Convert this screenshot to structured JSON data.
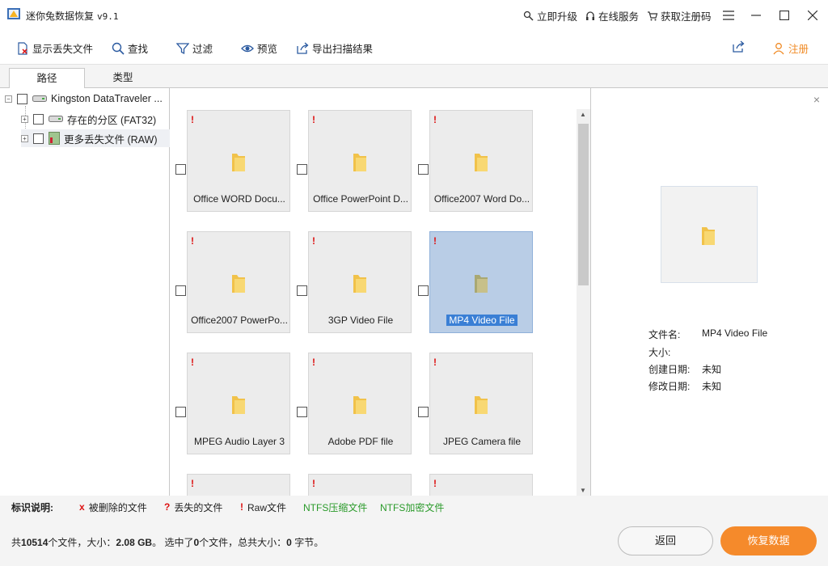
{
  "app": {
    "title": "迷你兔数据恢复",
    "version": "v9.1"
  },
  "topbar": {
    "upgrade": "立即升级",
    "online_service": "在线服务",
    "get_code": "获取注册码"
  },
  "toolbar": {
    "show_lost": "显示丢失文件",
    "find": "查找",
    "filter": "过滤",
    "preview": "预览",
    "export": "导出扫描结果",
    "register": "注册",
    "register_color": "#f08a24"
  },
  "tabs": [
    "路径",
    "类型"
  ],
  "tree": {
    "root": "Kingston DataTraveler ...",
    "children": [
      {
        "label": "存在的分区 (FAT32)"
      },
      {
        "label": "更多丢失文件 (RAW)"
      }
    ]
  },
  "grid": {
    "items": [
      {
        "caption": "Office WORD Docu...",
        "lost_mark": "!"
      },
      {
        "caption": "Office PowerPoint D...",
        "lost_mark": "!"
      },
      {
        "caption": "Office2007 Word Do...",
        "lost_mark": "!"
      },
      {
        "caption": "Office2007 PowerPo...",
        "lost_mark": "!"
      },
      {
        "caption": "3GP Video File",
        "lost_mark": "!"
      },
      {
        "caption": "MP4 Video File",
        "lost_mark": "!",
        "selected": true
      },
      {
        "caption": "MPEG Audio Layer 3",
        "lost_mark": "!"
      },
      {
        "caption": "Adobe PDF file",
        "lost_mark": "!"
      },
      {
        "caption": "JPEG Camera file",
        "lost_mark": "!"
      },
      {
        "caption": "",
        "lost_mark": "!"
      },
      {
        "caption": "",
        "lost_mark": "!"
      },
      {
        "caption": "",
        "lost_mark": "!"
      }
    ]
  },
  "preview": {
    "close": "×",
    "file_name_label": "文件名:",
    "file_name": "MP4 Video File",
    "size_label": "大小:",
    "size": "",
    "created_label": "创建日期:",
    "created": "未知",
    "modified_label": "修改日期:",
    "modified": "未知"
  },
  "legend": {
    "title": "标识说明:",
    "deleted_mark": "x",
    "deleted": "被删除的文件",
    "lost_mark": "?",
    "lost": "丢失的文件",
    "raw_mark": "!",
    "raw": "Raw文件",
    "ntfs_compressed": "NTFS压缩文件",
    "ntfs_encrypted": "NTFS加密文件",
    "mark_color": "#d11111",
    "ntfs_color": "#2a9a2a"
  },
  "status": {
    "p1": "共",
    "file_count": "10514",
    "p2": "个文件，大小：",
    "size": "2.08 GB",
    "p3": "。 选中了",
    "selected_count": "0",
    "p4": "个文件，总共大小：",
    "selected_size": "0",
    "p5": "字节。"
  },
  "buttons": {
    "back": "返回",
    "recover": "恢复数据",
    "recover_color": "#f58a2b"
  }
}
